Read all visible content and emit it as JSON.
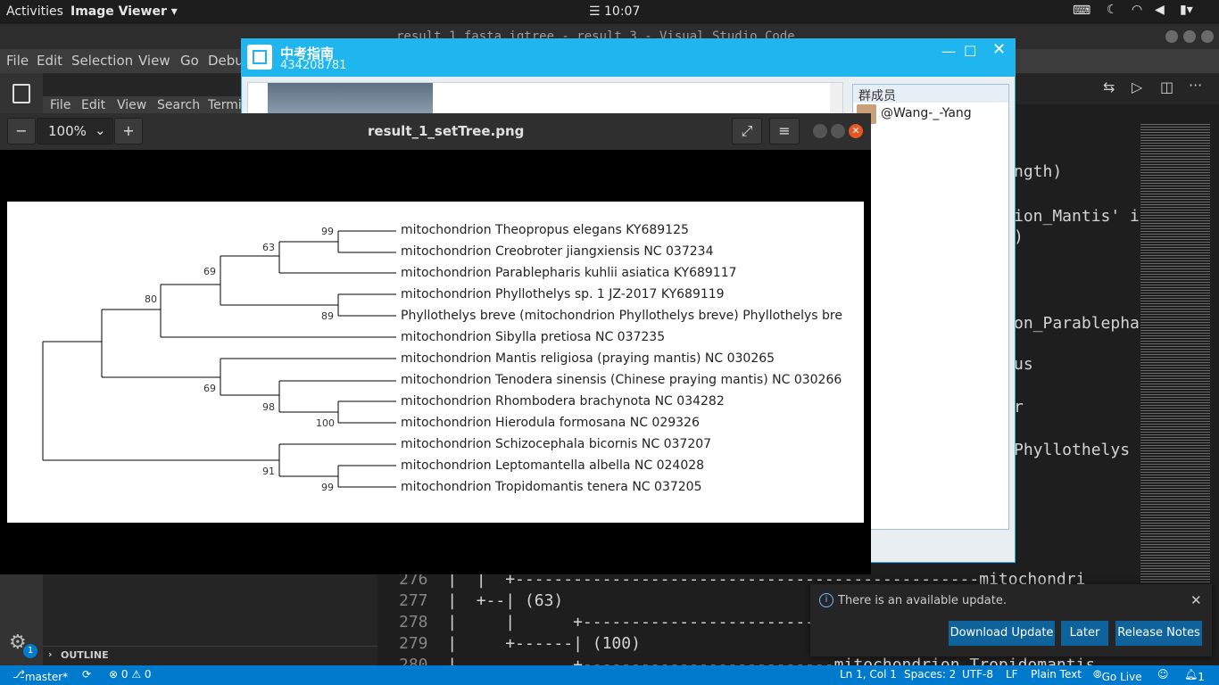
{
  "top_bar": {
    "activities": "Activities",
    "app_menu": "Image Viewer ▾",
    "clock": "☰ 10:07"
  },
  "vscode": {
    "title": "result_1.fasta.iqtree - result_3 - Visual Studio Code",
    "menu": [
      "File",
      "Edit",
      "Selection",
      "View",
      "Go",
      "Debu"
    ],
    "code_fragments": [
      "ngth)",
      "ion_Mantis' is",
      ")",
      "on_Parablephar",
      "us",
      "r",
      "Phyllothelys"
    ],
    "lines": [
      {
        "num": "276",
        "text": "|  |  +------------------------------------------------mitochondri"
      },
      {
        "num": "277",
        "text": "|  +--| (63)"
      },
      {
        "num": "278",
        "text": "|     |      +----------------------------"
      },
      {
        "num": "279",
        "text": "|     +------| (100)"
      },
      {
        "num": "280",
        "text": "|            +--------------------------mitochondrion_Tropidomantis"
      }
    ],
    "outline": "OUTLINE",
    "notification": {
      "text": "There is an available update.",
      "download": "Download Update",
      "later": "Later",
      "release": "Release Notes"
    },
    "status": {
      "branch": "master*",
      "problems": "⊗ 0 ⚠ 0",
      "position": "Ln 1, Col 1",
      "spaces": "Spaces: 2",
      "encoding": "UTF-8",
      "eol": "LF",
      "language": "Plain Text",
      "golive": "Go Live",
      "bell": "1"
    }
  },
  "qq": {
    "name": "中考指南",
    "id": "434208781",
    "members_header": "群成员",
    "member": "@Wang-_-Yang",
    "inner_menu": [
      "File",
      "Edit",
      "View",
      "Search",
      "Termi"
    ]
  },
  "viewer": {
    "zoom": "100%",
    "filename": "result_1_setTree.png"
  },
  "tree": {
    "leaves": [
      "mitochondrion Theopropus elegans KY689125",
      "mitochondrion Creobroter jiangxiensis NC 037234",
      "mitochondrion Parablepharis kuhlii asiatica KY689117",
      "mitochondrion Phyllothelys sp. 1 JZ-2017 KY689119",
      "Phyllothelys breve (mitochondrion Phyllothelys breve) Phyllothelys bre",
      "mitochondrion Sibylla pretiosa NC 037235",
      "mitochondrion Mantis religiosa (praying mantis) NC 030265",
      "mitochondrion Tenodera sinensis (Chinese praying mantis) NC 030266",
      "mitochondrion Rhombodera brachynota NC 034282",
      "mitochondrion Hierodula formosana NC 029326",
      "mitochondrion Schizocephala bicornis NC 037207",
      "mitochondrion Leptomantella albella NC 024028",
      "mitochondrion Tropidomantis tenera NC 037205"
    ],
    "bootstrap": [
      "99",
      "63",
      "69",
      "80",
      "89",
      "69",
      "98",
      "100",
      "91",
      "99"
    ]
  },
  "colors": {
    "vscode_blue": "#007acc",
    "qq_blue": "#1fb6f0",
    "close_orange": "#e95420"
  }
}
